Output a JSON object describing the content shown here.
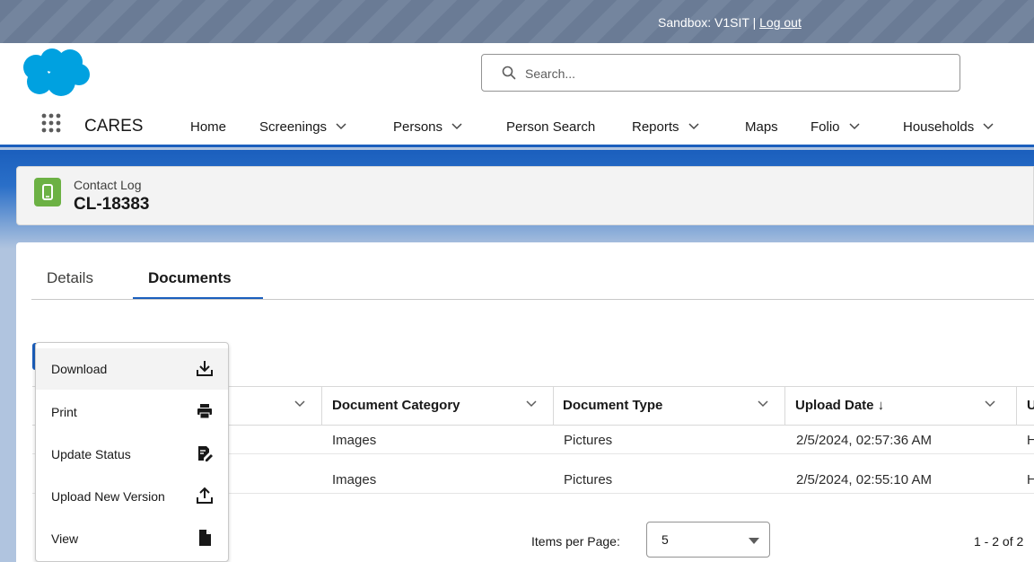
{
  "sandbox": {
    "prefix": "Sandbox: V1SIT | ",
    "logout": "Log out"
  },
  "search": {
    "placeholder": "Search..."
  },
  "nav": {
    "app_name": "CARES",
    "items": [
      {
        "label": "Home",
        "has_menu": false
      },
      {
        "label": "Screenings",
        "has_menu": true
      },
      {
        "label": "Persons",
        "has_menu": true
      },
      {
        "label": "Person Search",
        "has_menu": false
      },
      {
        "label": "Reports",
        "has_menu": true
      },
      {
        "label": "Maps",
        "has_menu": false
      },
      {
        "label": "Folio",
        "has_menu": true
      },
      {
        "label": "Households",
        "has_menu": true
      }
    ]
  },
  "record": {
    "type": "Contact Log",
    "name": "CL-18383"
  },
  "tabs": [
    {
      "label": "Details",
      "active": false
    },
    {
      "label": "Documents",
      "active": true
    }
  ],
  "table": {
    "columns": [
      "Document Category",
      "Document Type",
      "Upload Date ↓",
      "U"
    ],
    "rows": [
      {
        "category": "Images",
        "type": "Pictures",
        "date": "2/5/2024, 02:57:36 AM",
        "extra": "H"
      },
      {
        "category": "Images",
        "type": "Pictures",
        "date": "2/5/2024, 02:55:10 AM",
        "extra": "H"
      }
    ]
  },
  "pagination": {
    "items_label": "Items per Page:",
    "selected": "5",
    "range": "1 - 2 of 2"
  },
  "menu": {
    "items": [
      {
        "label": "Download",
        "icon": "download-icon"
      },
      {
        "label": "Print",
        "icon": "print-icon"
      },
      {
        "label": "Update Status",
        "icon": "edit-document-icon"
      },
      {
        "label": "Upload New Version",
        "icon": "upload-icon"
      },
      {
        "label": "View",
        "icon": "file-icon"
      }
    ]
  },
  "colors": {
    "brand_blue": "#1b5fbd",
    "record_icon_green": "#6cb144",
    "sandbox_bar": "#6a7b95"
  }
}
